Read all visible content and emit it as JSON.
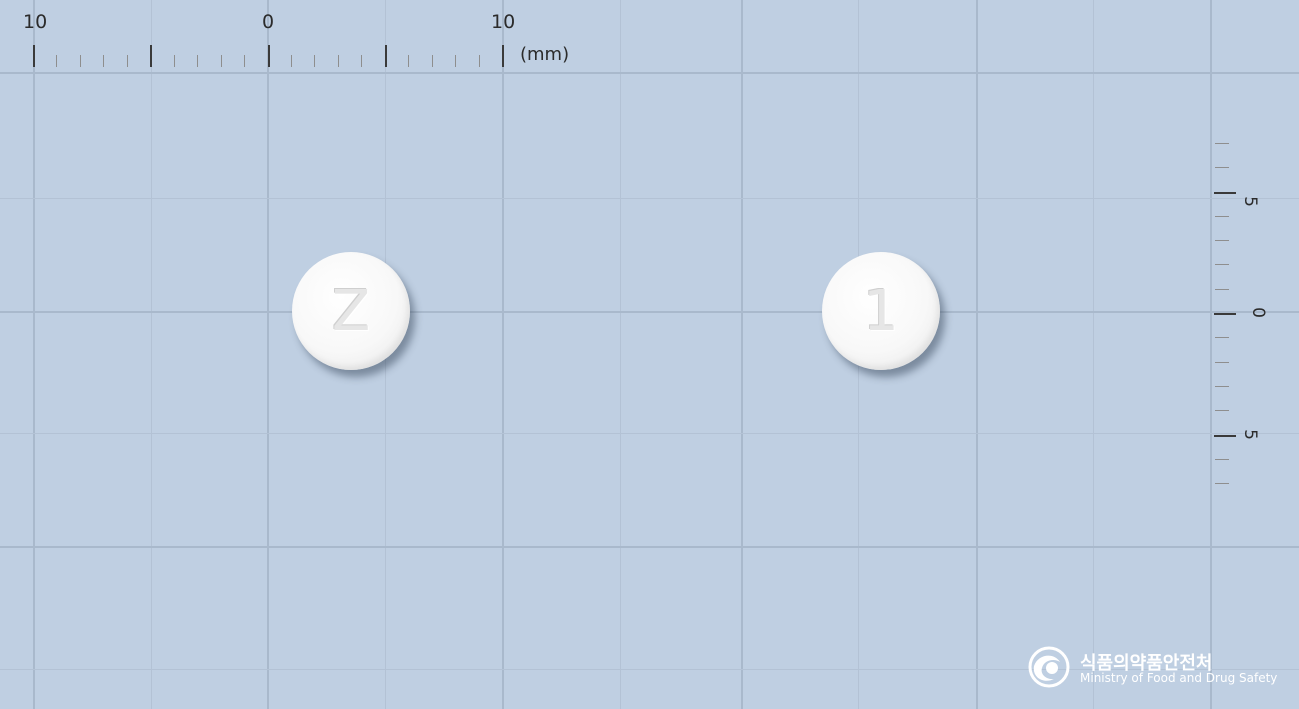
{
  "ruler_top": {
    "labels": [
      "10",
      "0",
      "10"
    ],
    "unit": "(mm)"
  },
  "ruler_right": {
    "labels": [
      "5",
      "0",
      "5"
    ]
  },
  "tablets": [
    {
      "imprint": "Z",
      "color": "#f7f7f7"
    },
    {
      "imprint": "1",
      "color": "#f7f7f7"
    }
  ],
  "logo": {
    "icon": "mfds-emblem-icon",
    "korean": "식품의약품안전처",
    "english": "Ministry of Food and Drug Safety"
  },
  "colors": {
    "background": "#bfcfe2",
    "grid": "#a9b9cc"
  }
}
